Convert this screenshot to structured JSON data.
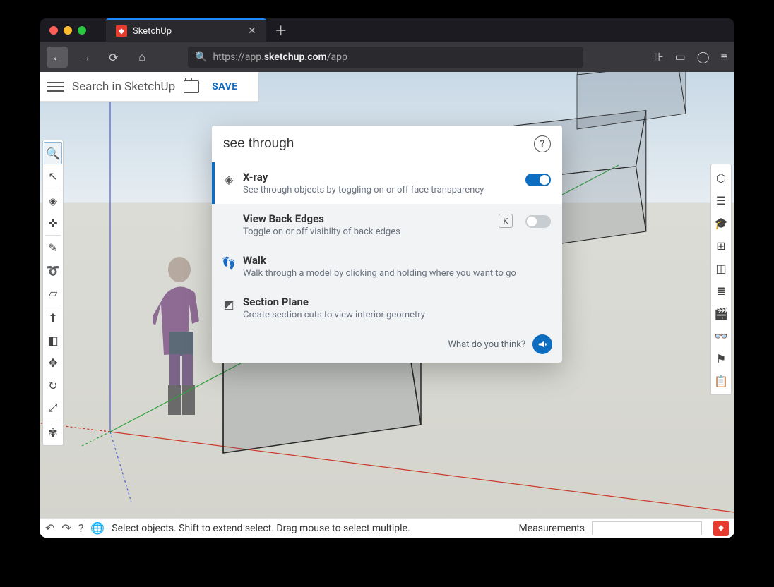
{
  "browser": {
    "tab_title": "SketchUp",
    "url_prefix": "https://app.",
    "url_bold": "sketchup.com",
    "url_suffix": "/app"
  },
  "app": {
    "search_placeholder": "Search in SketchUp",
    "save_label": "SAVE"
  },
  "search_popup": {
    "query": "see through",
    "results": [
      {
        "title": "X-ray",
        "desc": "See through objects by toggling on or off face transparency",
        "toggle": "on",
        "selected": true
      },
      {
        "title": "View Back Edges",
        "desc": "Toggle on or off visibilty of back edges",
        "shortcut": "K",
        "toggle": "off"
      },
      {
        "title": "Walk",
        "desc": "Walk through a model by clicking and holding where you want to go"
      },
      {
        "title": "Section Plane",
        "desc": "Create section cuts to view interior geometry"
      }
    ],
    "footer_label": "What do you think?"
  },
  "statusbar": {
    "hint": "Select objects. Shift to extend select. Drag mouse to select multiple.",
    "measure_label": "Measurements"
  },
  "left_tools": [
    "search",
    "select",
    "eraser",
    "paint",
    "line",
    "arc",
    "shape",
    "pushpull",
    "offset",
    "move",
    "rotate",
    "scale",
    "tape"
  ],
  "right_tools": [
    "iso",
    "layers",
    "instructor",
    "components",
    "materials",
    "styles",
    "scenes",
    "display",
    "views",
    "outliner"
  ]
}
